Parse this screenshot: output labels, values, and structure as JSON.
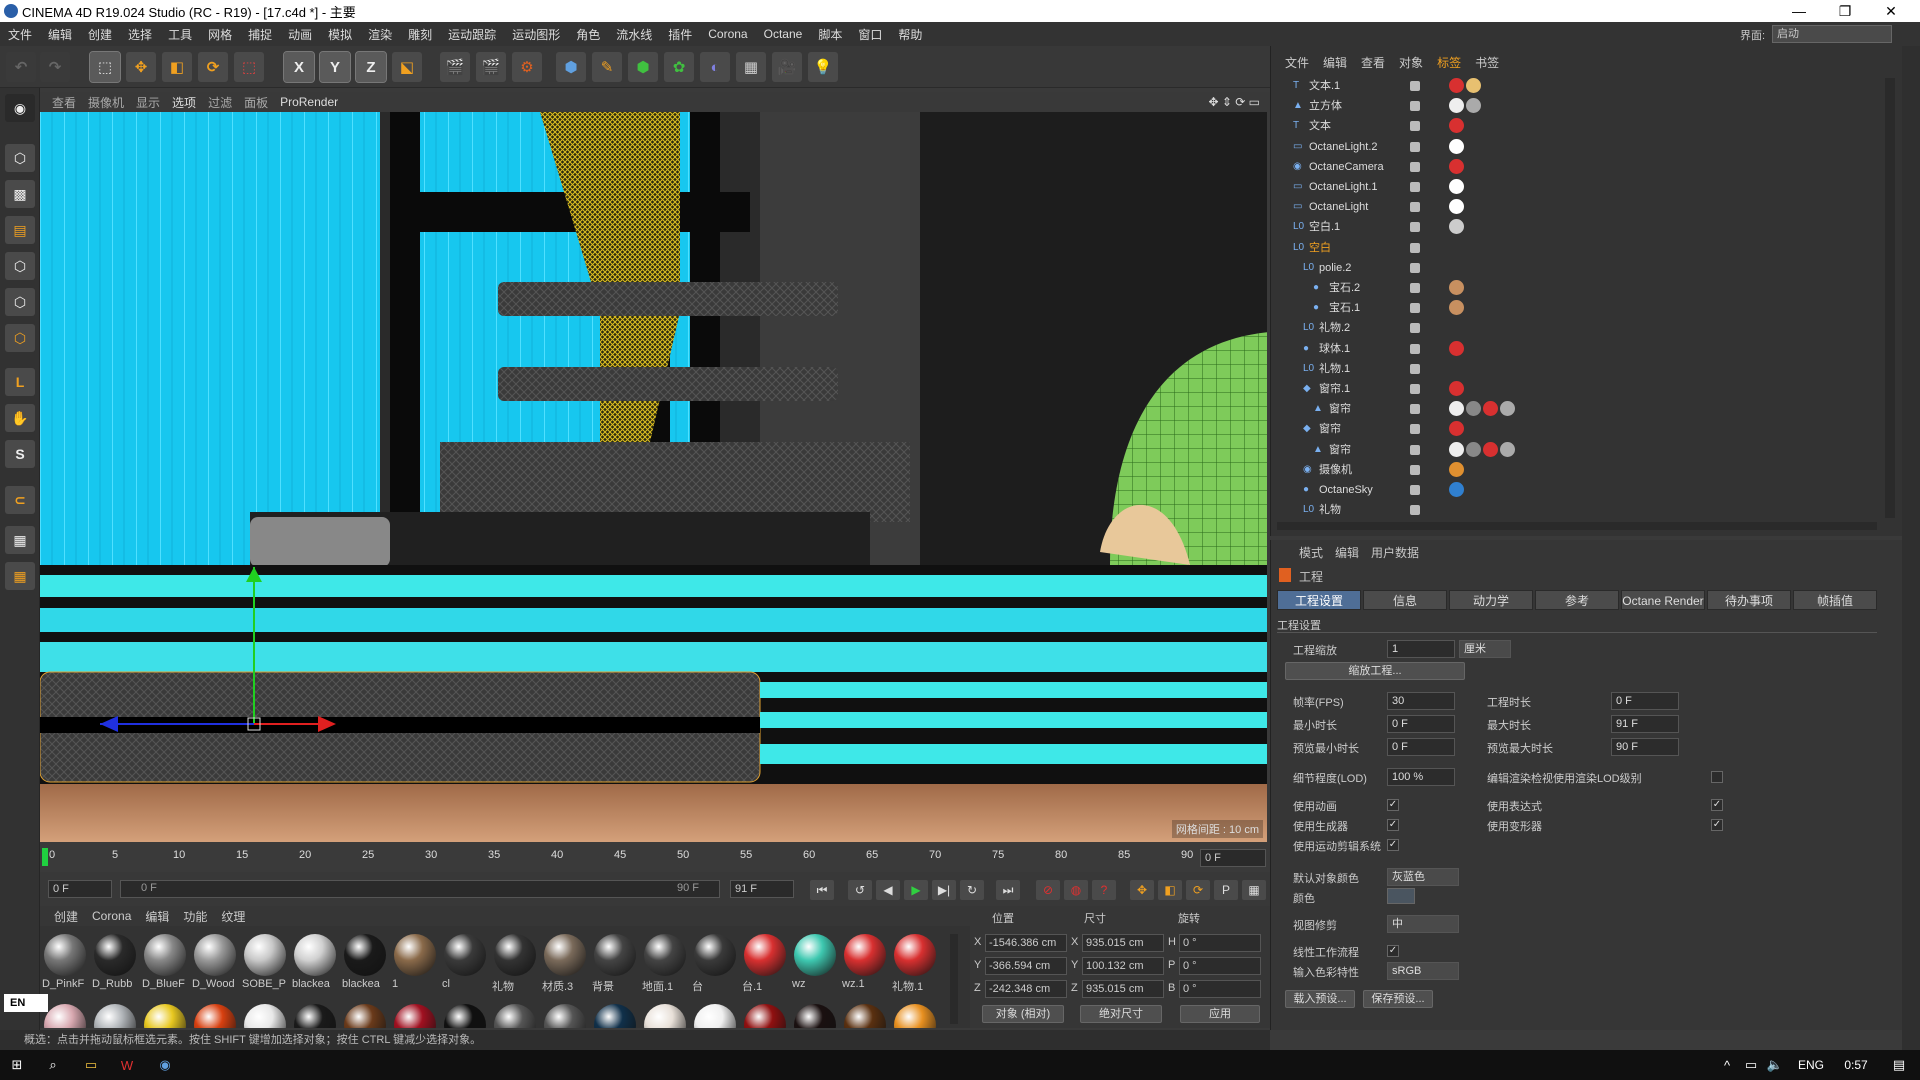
{
  "window": {
    "title": "CINEMA 4D R19.024 Studio (RC - R19) - [17.c4d *] - 主要",
    "min": "—",
    "max": "❐",
    "close": "✕"
  },
  "menu": [
    "文件",
    "编辑",
    "创建",
    "选择",
    "工具",
    "网格",
    "捕捉",
    "动画",
    "模拟",
    "渲染",
    "雕刻",
    "运动跟踪",
    "运动图形",
    "角色",
    "流水线",
    "插件",
    "Corona",
    "Octane",
    "脚本",
    "窗口",
    "帮助"
  ],
  "interface": {
    "label": "界面:",
    "value": "启动"
  },
  "toolbar": {
    "x": "X",
    "y": "Y",
    "z": "Z"
  },
  "viewport": {
    "menu": [
      "查看",
      "摄像机",
      "显示",
      "选项",
      "过滤",
      "面板",
      "ProRender"
    ],
    "active_menu": "选项",
    "grid_label": "网格间距 : 10 cm"
  },
  "timeline": {
    "ticks": [
      "0",
      "5",
      "10",
      "15",
      "20",
      "25",
      "30",
      "35",
      "40",
      "45",
      "50",
      "55",
      "60",
      "65",
      "70",
      "75",
      "80",
      "85",
      "90"
    ],
    "current": "0 F"
  },
  "playback": {
    "start": "0 F",
    "range_start": "0 F",
    "range_end": "90 F",
    "end": "91 F"
  },
  "materials": {
    "menu": [
      "创建",
      "Corona",
      "编辑",
      "功能",
      "纹理"
    ],
    "row1": [
      {
        "name": "D_PinkF",
        "color": "#777"
      },
      {
        "name": "D_Rubb",
        "color": "#2a2a2a"
      },
      {
        "name": "D_BlueF",
        "color": "#888"
      },
      {
        "name": "D_Wood",
        "color": "#999"
      },
      {
        "name": "SOBE_P",
        "color": "#c8c8c8"
      },
      {
        "name": "blackea",
        "color": "#d0d0d0"
      },
      {
        "name": "blackea",
        "color": "#1a1a1a"
      },
      {
        "name": "1",
        "color": "#8a6a4a"
      },
      {
        "name": "cl",
        "color": "#3a3a3a"
      },
      {
        "name": "礼物",
        "color": "#333"
      },
      {
        "name": "材质.3",
        "color": "#7a6a5a"
      },
      {
        "name": "背景",
        "color": "#444"
      },
      {
        "name": "地面.1",
        "color": "#444"
      },
      {
        "name": "台",
        "color": "#3a3a3a"
      },
      {
        "name": "台.1",
        "color": "#d83030"
      },
      {
        "name": "wz",
        "color": "#3ec8b0"
      },
      {
        "name": "wz.1",
        "color": "#d83030"
      },
      {
        "name": "礼物.1",
        "color": "#d83030"
      }
    ],
    "row2": [
      "#d8a8b0",
      "#b0b4b8",
      "#e8c820",
      "#d84010",
      "#e8e8e8",
      "#1a1a1a",
      "#6a3a1a",
      "#a01020",
      "#101010",
      "#555",
      "#555",
      "#10304a",
      "#e8e0d8",
      "#f0f0f0",
      "#901010",
      "#1a1010",
      "#5a3010",
      "#e89020"
    ]
  },
  "coords": {
    "headers": [
      "位置",
      "尺寸",
      "旋转"
    ],
    "rows": [
      {
        "axis": "X",
        "pos": "-1546.386 cm",
        "size_axis": "X",
        "size": "935.015 cm",
        "rot_axis": "H",
        "rot": "0 °"
      },
      {
        "axis": "Y",
        "pos": "-366.594 cm",
        "size_axis": "Y",
        "size": "100.132 cm",
        "rot_axis": "P",
        "rot": "0 °"
      },
      {
        "axis": "Z",
        "pos": "-242.348 cm",
        "size_axis": "Z",
        "size": "935.015 cm",
        "rot_axis": "B",
        "rot": "0 °"
      }
    ],
    "mode": "对象 (相对)",
    "size_mode": "绝对尺寸",
    "apply": "应用"
  },
  "status": "概选：点击并拖动鼠标框选元素。按住 SHIFT 键增加选择对象；按住 CTRL 键减少选择对象。",
  "lang": "EN",
  "objects": {
    "menu": [
      "文件",
      "编辑",
      "查看",
      "对象",
      "标签",
      "书签"
    ],
    "rows": [
      {
        "name": "文本.1",
        "icon": "T",
        "indent": 0,
        "tags": [
          "#d83030",
          "#e8c070"
        ]
      },
      {
        "name": "立方体",
        "icon": "▲",
        "indent": 0,
        "tags": [
          "#eee",
          "#aaa"
        ]
      },
      {
        "name": "文本",
        "icon": "T",
        "indent": 0,
        "tags": [
          "#d83030"
        ]
      },
      {
        "name": "OctaneLight.2",
        "icon": "▭",
        "indent": 0,
        "tags": [
          "#fff"
        ]
      },
      {
        "name": "OctaneCamera",
        "icon": "◉",
        "indent": 0,
        "tags": [
          "#d83030"
        ]
      },
      {
        "name": "OctaneLight.1",
        "icon": "▭",
        "indent": 0,
        "tags": [
          "#fff"
        ]
      },
      {
        "name": "OctaneLight",
        "icon": "▭",
        "indent": 0,
        "tags": [
          "#fff"
        ]
      },
      {
        "name": "空白.1",
        "icon": "L0",
        "indent": 0,
        "tags": [
          "#ccc"
        ]
      },
      {
        "name": "空白",
        "icon": "L0",
        "indent": 0,
        "tags": [],
        "highlight": true
      },
      {
        "name": "polie.2",
        "icon": "L0",
        "indent": 1,
        "tags": []
      },
      {
        "name": "宝石.2",
        "icon": "●",
        "indent": 2,
        "tags": [
          "#c89060"
        ]
      },
      {
        "name": "宝石.1",
        "icon": "●",
        "indent": 2,
        "tags": [
          "#c89060"
        ]
      },
      {
        "name": "礼物.2",
        "icon": "L0",
        "indent": 1,
        "tags": []
      },
      {
        "name": "球体.1",
        "icon": "●",
        "indent": 1,
        "tags": [
          "#d83030"
        ]
      },
      {
        "name": "礼物.1",
        "icon": "L0",
        "indent": 1,
        "tags": []
      },
      {
        "name": "窗帘.1",
        "icon": "◆",
        "indent": 1,
        "tags": [
          "#d83030"
        ]
      },
      {
        "name": "窗帘",
        "icon": "▲",
        "indent": 2,
        "tags": [
          "#eee",
          "#888",
          "#d83030",
          "#aaa"
        ]
      },
      {
        "name": "窗帘",
        "icon": "◆",
        "indent": 1,
        "tags": [
          "#d83030"
        ]
      },
      {
        "name": "窗帘",
        "icon": "▲",
        "indent": 2,
        "tags": [
          "#eee",
          "#888",
          "#d83030",
          "#aaa"
        ]
      },
      {
        "name": "摄像机",
        "icon": "◉",
        "indent": 1,
        "tags": [
          "#e09030"
        ]
      },
      {
        "name": "OctaneSky",
        "icon": "●",
        "indent": 1,
        "tags": [
          "#3080d0"
        ]
      },
      {
        "name": "礼物",
        "icon": "L0",
        "indent": 1,
        "tags": []
      }
    ]
  },
  "attributes": {
    "menu": [
      "模式",
      "编辑",
      "用户数据"
    ],
    "title": "工程",
    "tabs": [
      "工程设置",
      "信息",
      "动力学",
      "参考",
      "Octane Render",
      "待办事项",
      "帧插值"
    ],
    "section": "工程设置",
    "scale_label": "工程缩放",
    "scale_value": "1",
    "scale_unit": "厘米",
    "scale_btn": "缩放工程...",
    "fps_label": "帧率(FPS)",
    "fps": "30",
    "time_label": "工程时长",
    "time": "0 F",
    "min_label": "最小时长",
    "min": "0 F",
    "max_label": "最大时长",
    "max": "91 F",
    "pmin_label": "预览最小时长",
    "pmin": "0 F",
    "pmax_label": "预览最大时长",
    "pmax": "90 F",
    "lod_label": "细节程度(LOD)",
    "lod": "100 %",
    "lod_check": "编辑渲染检视使用渲染LOD级别",
    "use_anim": "使用动画",
    "use_expr": "使用表达式",
    "use_gen": "使用生成器",
    "use_deform": "使用变形器",
    "use_mograph": "使用运动剪辑系统",
    "def_color_label": "默认对象颜色",
    "def_color": "灰蓝色",
    "color_label": "颜色",
    "view_clip_label": "视图修剪",
    "view_clip": "中",
    "linear_label": "线性工作流程",
    "input_color_label": "输入色彩特性",
    "input_color": "sRGB",
    "load_btn": "载入预设...",
    "save_btn": "保存预设..."
  },
  "taskbar": {
    "ime": "ENG",
    "time": "0:57"
  }
}
